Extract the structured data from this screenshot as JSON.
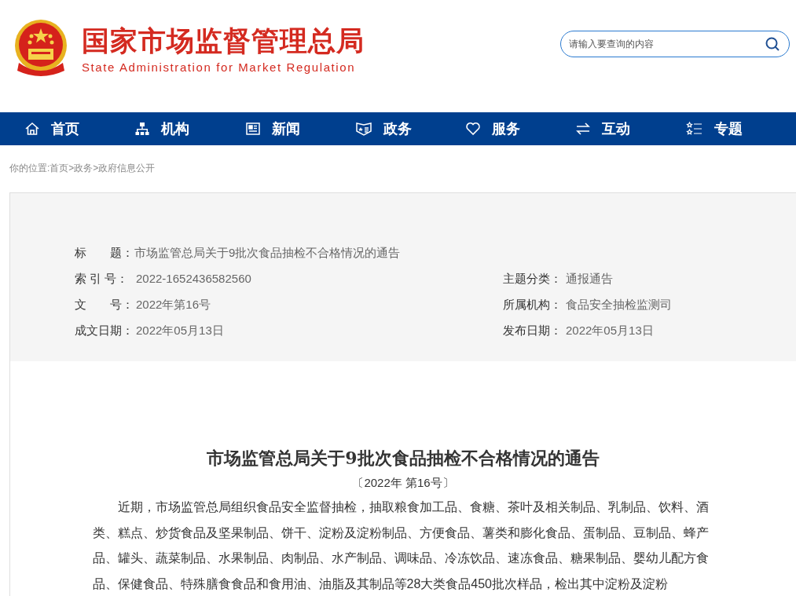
{
  "header": {
    "site_title": "国家市场监督管理总局",
    "site_subtitle": "State Administration for Market Regulation",
    "search": {
      "placeholder": "请输入要查询的内容"
    }
  },
  "nav": [
    {
      "label": "首页",
      "kind": "home"
    },
    {
      "label": "机构",
      "kind": "org"
    },
    {
      "label": "新闻",
      "kind": "news"
    },
    {
      "label": "政务",
      "kind": "gov"
    },
    {
      "label": "服务",
      "kind": "service"
    },
    {
      "label": "互动",
      "kind": "interact"
    },
    {
      "label": "专题",
      "kind": "topic"
    }
  ],
  "breadcrumb": {
    "prefix": "你的位置:",
    "items": [
      "首页",
      "政务",
      "政府信息公开"
    ],
    "separator": ">"
  },
  "meta": {
    "title": {
      "label": "标　　题：",
      "value": "市场监管总局关于9批次食品抽检不合格情况的通告"
    },
    "rows": [
      {
        "left": {
          "label": "索 引 号：",
          "value": "2022-1652436582560"
        },
        "right": {
          "label": "主题分类：",
          "value": "通报通告"
        }
      },
      {
        "left": {
          "label": "文　　号：",
          "value": "2022年第16号"
        },
        "right": {
          "label": "所属机构：",
          "value": "食品安全抽检监测司"
        }
      },
      {
        "left": {
          "label": "成文日期：",
          "value": "2022年05月13日"
        },
        "right": {
          "label": "发布日期：",
          "value": "2022年05月13日"
        }
      }
    ]
  },
  "article": {
    "title": "市场监管总局关于9批次食品抽检不合格情况的通告",
    "number": "〔2022年 第16号〕",
    "paragraph": "近期，市场监管总局组织食品安全监督抽检，抽取粮食加工品、食糖、茶叶及相关制品、乳制品、饮料、酒类、糕点、炒货食品及坚果制品、饼干、淀粉及淀粉制品、方便食品、薯类和膨化食品、蛋制品、豆制品、蜂产品、罐头、蔬菜制品、水果制品、肉制品、水产制品、调味品、冷冻饮品、速冻食品、糖果制品、婴幼儿配方食品、保健食品、特殊膳食食品和食用油、油脂及其制品等28大类食品450批次样品，检出其中淀粉及淀粉"
  }
}
